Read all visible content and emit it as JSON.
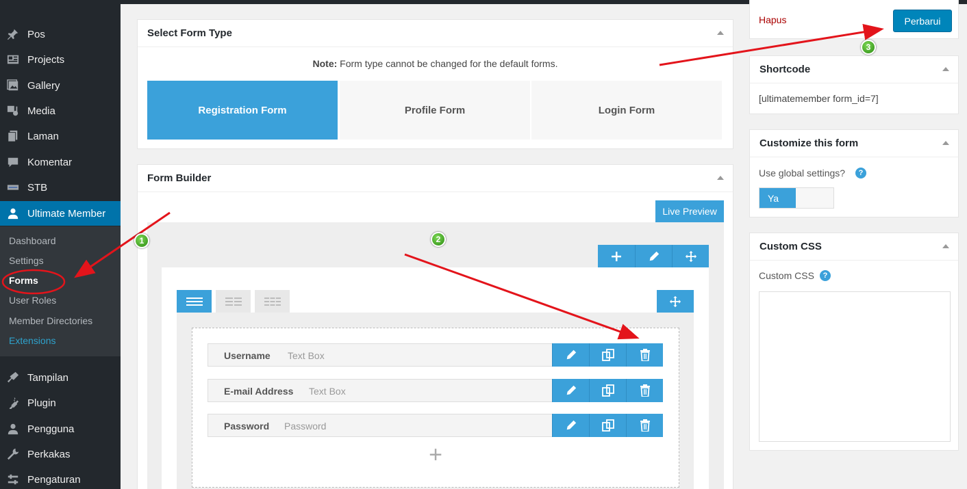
{
  "sidebar": {
    "items": [
      {
        "label": "Pos",
        "icon": "pin-icon"
      },
      {
        "label": "Projects",
        "icon": "portfolio-icon"
      },
      {
        "label": "Gallery",
        "icon": "gallery-icon"
      },
      {
        "label": "Media",
        "icon": "media-icon"
      },
      {
        "label": "Laman",
        "icon": "pages-icon"
      },
      {
        "label": "Komentar",
        "icon": "comments-icon"
      },
      {
        "label": "STB",
        "icon": "stb-icon"
      },
      {
        "label": "Ultimate Member",
        "icon": "user-icon"
      },
      {
        "label": "Tampilan",
        "icon": "appearance-icon"
      },
      {
        "label": "Plugin",
        "icon": "plugin-icon"
      },
      {
        "label": "Pengguna",
        "icon": "users-icon"
      },
      {
        "label": "Perkakas",
        "icon": "tools-icon"
      },
      {
        "label": "Pengaturan",
        "icon": "settings-icon"
      }
    ],
    "submenu": [
      "Dashboard",
      "Settings",
      "Forms",
      "User Roles",
      "Member Directories",
      "Extensions"
    ]
  },
  "form_type": {
    "title": "Select Form Type",
    "note_bold": "Note:",
    "note_text": " Form type cannot be changed for the default forms.",
    "tabs": [
      "Registration Form",
      "Profile Form",
      "Login Form"
    ],
    "selected": "Registration Form"
  },
  "form_builder": {
    "title": "Form Builder",
    "live_preview": "Live Preview",
    "fields": [
      {
        "label": "Username",
        "type": "Text Box"
      },
      {
        "label": "E-mail Address",
        "type": "Text Box"
      },
      {
        "label": "Password",
        "type": "Password"
      }
    ],
    "add_symbol": "+"
  },
  "publish": {
    "delete": "Hapus",
    "update": "Perbarui"
  },
  "shortcode": {
    "title": "Shortcode",
    "value": "[ultimatemember form_id=7]"
  },
  "customize": {
    "title": "Customize this form",
    "label": "Use global settings?",
    "toggle_on": "Ya"
  },
  "custom_css": {
    "title": "Custom CSS",
    "label": "Custom CSS",
    "value": ""
  },
  "annotations": [
    "1",
    "2",
    "3"
  ],
  "colors": {
    "accent": "#3ba1da",
    "sidebar": "#23282d",
    "active_menu": "#0073aa",
    "arrow": "#e3141b",
    "delete_link": "#a00"
  }
}
